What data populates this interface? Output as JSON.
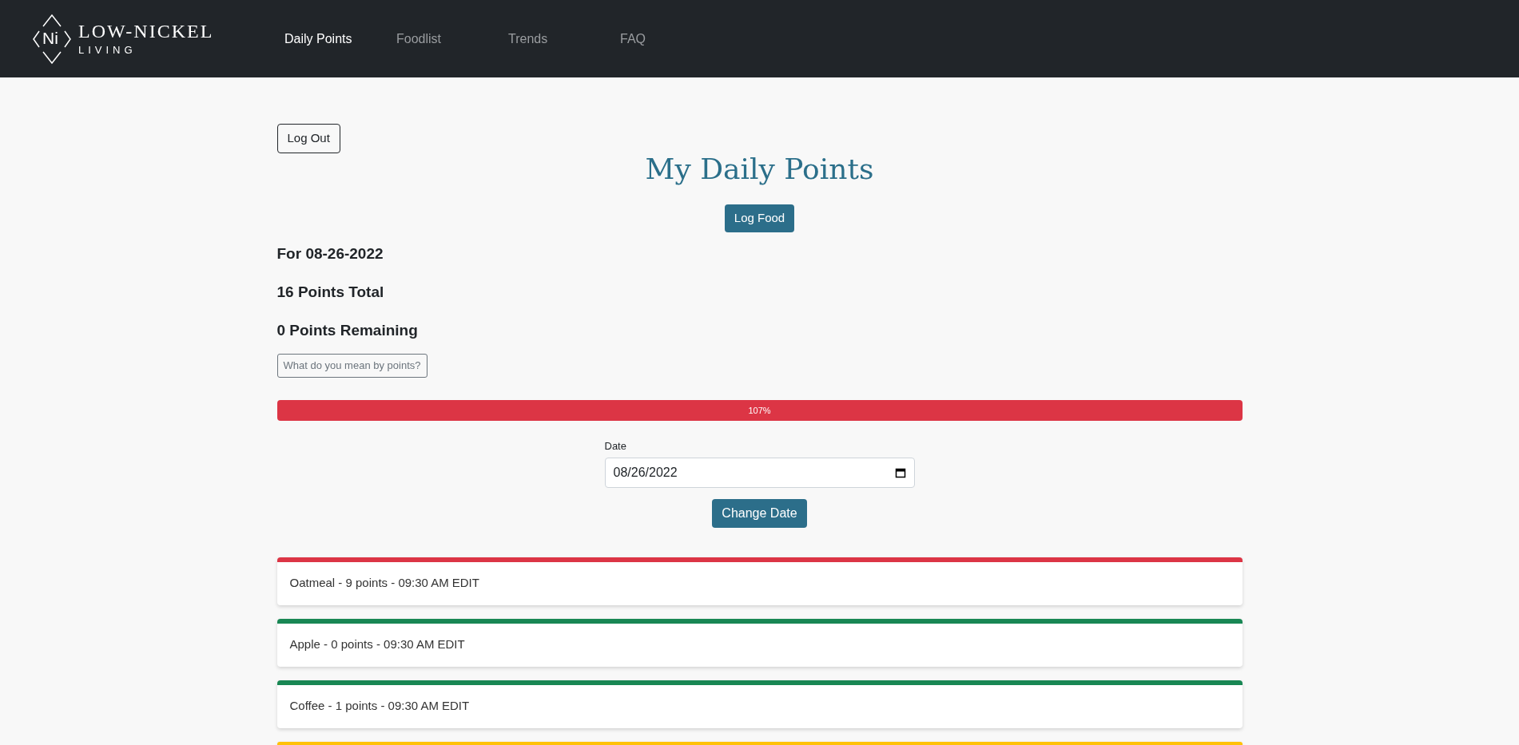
{
  "brand": {
    "mark": "Ni",
    "name": "LOW-NICKEL",
    "tagline": "LIVING"
  },
  "nav": [
    {
      "label": "Daily Points",
      "selected": true
    },
    {
      "label": "Foodlist",
      "selected": false
    },
    {
      "label": "Trends",
      "selected": false
    },
    {
      "label": "FAQ",
      "selected": false
    }
  ],
  "logout_button": "Log Out",
  "title": "My Daily Points",
  "log_food_button": "Log Food",
  "summary": [
    "For 08-26-2022",
    "16 Points Total",
    "0 Points Remaining"
  ],
  "points_help_button": "What do you mean by points?",
  "progress": {
    "level": 1,
    "label": "107%"
  },
  "date_field": {
    "label": "Date",
    "value": "08/26/2022"
  },
  "change_date_button": "Change Date",
  "entries": [
    {
      "text": "Oatmeal - 9 points - 09:30 AM",
      "edit": "EDIT",
      "color": "#dc3545"
    },
    {
      "text": "Apple - 0 points - 09:30 AM",
      "edit": "EDIT",
      "color": "#198754"
    },
    {
      "text": "Coffee - 1 points - 09:30 AM",
      "edit": "EDIT",
      "color": "#198754"
    },
    {
      "color": "#ffc107"
    }
  ]
}
